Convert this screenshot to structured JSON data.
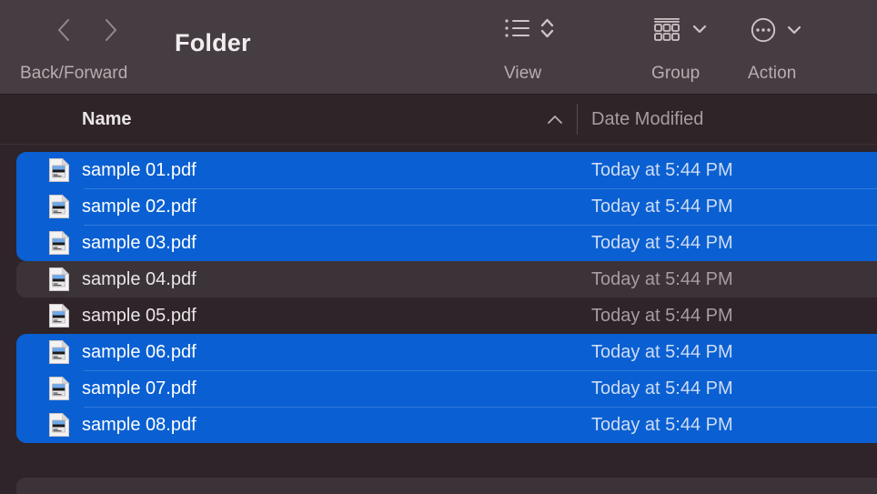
{
  "window": {
    "title": "Folder",
    "background_color": "#2e2429"
  },
  "toolbar": {
    "background_color": "#453d41",
    "back_label": "Back",
    "forward_label": "Forward",
    "back_forward_caption": "Back/Forward",
    "view_caption": "View",
    "group_caption": "Group",
    "action_caption": "Action",
    "icons": {
      "back": "chevron-left-icon",
      "forward": "chevron-right-icon",
      "view": "list-view-icon",
      "view_stepper": "up-down-chevron-icon",
      "group": "group-grid-icon",
      "group_dropdown": "chevron-down-icon",
      "action": "ellipsis-circle-icon",
      "action_dropdown": "chevron-down-icon"
    }
  },
  "columns": {
    "name_label": "Name",
    "date_label": "Date Modified",
    "sort_direction": "ascending",
    "sort_indicator": "chevron-up-icon",
    "background_color": "#2f2529"
  },
  "selection": {
    "color": "#0a60d2",
    "stripe_color": "#3c3339"
  },
  "files": [
    {
      "name": "sample 01.pdf",
      "date": "Today at 5:44 PM",
      "selected": true,
      "icon": "pdf-file-icon"
    },
    {
      "name": "sample 02.pdf",
      "date": "Today at 5:44 PM",
      "selected": true,
      "icon": "pdf-file-icon"
    },
    {
      "name": "sample 03.pdf",
      "date": "Today at 5:44 PM",
      "selected": true,
      "icon": "pdf-file-icon"
    },
    {
      "name": "sample 04.pdf",
      "date": "Today at 5:44 PM",
      "selected": false,
      "icon": "pdf-file-icon"
    },
    {
      "name": "sample 05.pdf",
      "date": "Today at 5:44 PM",
      "selected": false,
      "icon": "pdf-file-icon"
    },
    {
      "name": "sample 06.pdf",
      "date": "Today at 5:44 PM",
      "selected": true,
      "icon": "pdf-file-icon"
    },
    {
      "name": "sample 07.pdf",
      "date": "Today at 5:44 PM",
      "selected": true,
      "icon": "pdf-file-icon"
    },
    {
      "name": "sample 08.pdf",
      "date": "Today at 5:44 PM",
      "selected": true,
      "icon": "pdf-file-icon"
    }
  ]
}
